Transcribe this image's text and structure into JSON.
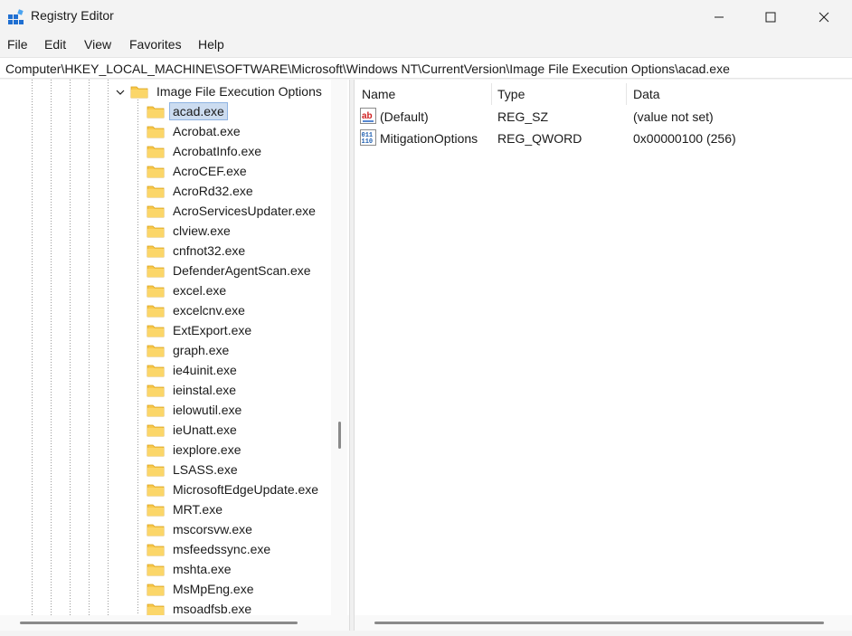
{
  "window": {
    "title": "Registry Editor",
    "icon": "registry-icon",
    "controls": [
      "minimize-icon",
      "maximize-icon",
      "close-icon"
    ]
  },
  "menubar": {
    "items": [
      "File",
      "Edit",
      "View",
      "Favorites",
      "Help"
    ]
  },
  "address": {
    "path": "Computer\\HKEY_LOCAL_MACHINE\\SOFTWARE\\Microsoft\\Windows NT\\CurrentVersion\\Image File Execution Options\\acad.exe"
  },
  "tree": {
    "parent": {
      "label": "Image File Execution Options",
      "expanded": true
    },
    "children": [
      "acad.exe",
      "Acrobat.exe",
      "AcrobatInfo.exe",
      "AcroCEF.exe",
      "AcroRd32.exe",
      "AcroServicesUpdater.exe",
      "clview.exe",
      "cnfnot32.exe",
      "DefenderAgentScan.exe",
      "excel.exe",
      "excelcnv.exe",
      "ExtExport.exe",
      "graph.exe",
      "ie4uinit.exe",
      "ieinstal.exe",
      "ielowutil.exe",
      "ieUnatt.exe",
      "iexplore.exe",
      "LSASS.exe",
      "MicrosoftEdgeUpdate.exe",
      "MRT.exe",
      "mscorsvw.exe",
      "msfeedssync.exe",
      "mshta.exe",
      "MsMpEng.exe",
      "msoadfsb.exe"
    ],
    "selected": "acad.exe"
  },
  "values": {
    "columns": {
      "name": "Name",
      "type": "Type",
      "data": "Data"
    },
    "rows": [
      {
        "icon": "string-value-icon",
        "name": "(Default)",
        "type": "REG_SZ",
        "data": "(value not set)"
      },
      {
        "icon": "binary-value-icon",
        "name": "MitigationOptions",
        "type": "REG_QWORD",
        "data": "0x00000100 (256)"
      }
    ]
  },
  "colors": {
    "selection": "#ccdcf0",
    "folder": "#f8c84a",
    "icon_blue": "#1f6fd1"
  }
}
